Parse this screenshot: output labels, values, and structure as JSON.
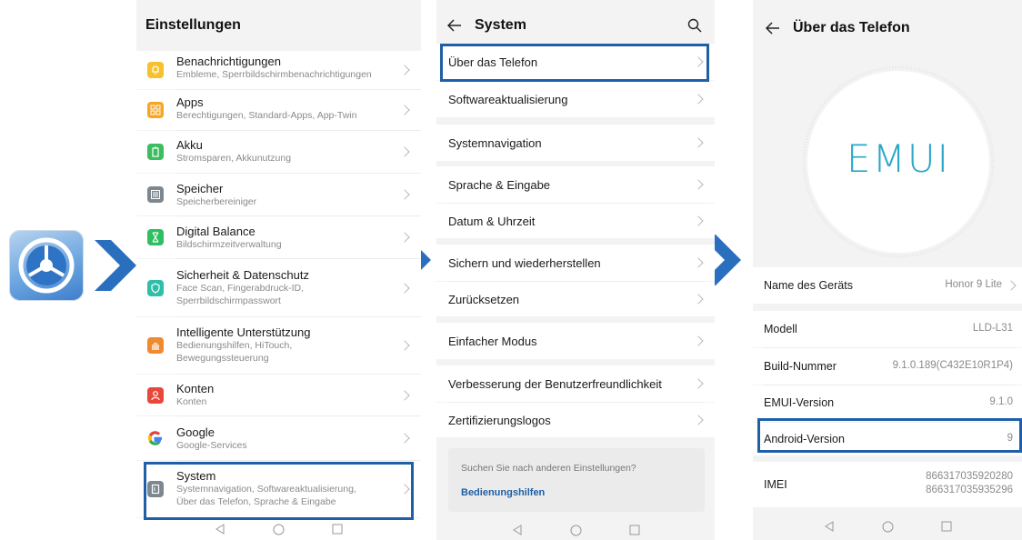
{
  "panel1": {
    "title": "Einstellungen",
    "items": [
      {
        "label": "Benachrichtigungen",
        "sub": "Embleme, Sperrbildschirmbenachrichtigungen",
        "icon": "bell-icon",
        "color": "#f6c12c"
      },
      {
        "label": "Apps",
        "sub": "Berechtigungen, Standard-Apps, App-Twin",
        "icon": "apps-grid-icon",
        "color": "#f6a623"
      },
      {
        "label": "Akku",
        "sub": "Stromsparen, Akkunutzung",
        "icon": "battery-icon",
        "color": "#3cbd5f"
      },
      {
        "label": "Speicher",
        "sub": "Speicherbereiniger",
        "icon": "storage-icon",
        "color": "#7d8790"
      },
      {
        "label": "Digital Balance",
        "sub": "Bildschirmzeitverwaltung",
        "icon": "hourglass-icon",
        "color": "#2fbe62"
      },
      {
        "label": "Sicherheit & Datenschutz",
        "sub": "Face Scan, Fingerabdruck-ID,",
        "sub2": "Sperrbildschirmpasswort",
        "icon": "shield-icon",
        "color": "#2fbfa8"
      },
      {
        "label": "Intelligente Unterstützung",
        "sub": "Bedienungshilfen, HiTouch,",
        "sub2": "Bewegungssteuerung",
        "icon": "hand-icon",
        "color": "#f08a30"
      },
      {
        "label": "Konten",
        "sub": "Konten",
        "icon": "account-icon",
        "color": "#e8473c"
      },
      {
        "label": "Google",
        "sub": "Google-Services",
        "icon": "google-icon",
        "color": "#4285f4"
      },
      {
        "label": "System",
        "sub": "Systemnavigation, Softwareaktualisierung,",
        "sub2": "Über das Telefon, Sprache & Eingabe",
        "icon": "system-icon",
        "color": "#7d8790"
      }
    ]
  },
  "panel2": {
    "title": "System",
    "items": [
      "Über das Telefon",
      "Softwareaktualisierung",
      "Systemnavigation",
      "Sprache & Eingabe",
      "Datum & Uhrzeit",
      "Sichern und wiederherstellen",
      "Zurücksetzen",
      "Einfacher Modus",
      "Verbesserung der Benutzerfreundlichkeit",
      "Zertifizierungslogos"
    ],
    "search_prompt": "Suchen Sie nach anderen Einstellungen?",
    "search_link": "Bedienungshilfen"
  },
  "panel3": {
    "title": "Über das Telefon",
    "logo": "EMUI",
    "rows": [
      {
        "key": "Name des Geräts",
        "value": "Honor 9 Lite"
      },
      {
        "key": "Modell",
        "value": "LLD-L31"
      },
      {
        "key": "Build-Nummer",
        "value": "9.1.0.189(C432E10R1P4)"
      },
      {
        "key": "EMUI-Version",
        "value": "9.1.0"
      },
      {
        "key": "Android-Version",
        "value": "9"
      },
      {
        "key": "IMEI",
        "value": "866317035920280",
        "value2": "866317035935296"
      }
    ]
  },
  "colors": {
    "highlight": "#1f5fa8",
    "chevron": "#2a6fbe"
  }
}
